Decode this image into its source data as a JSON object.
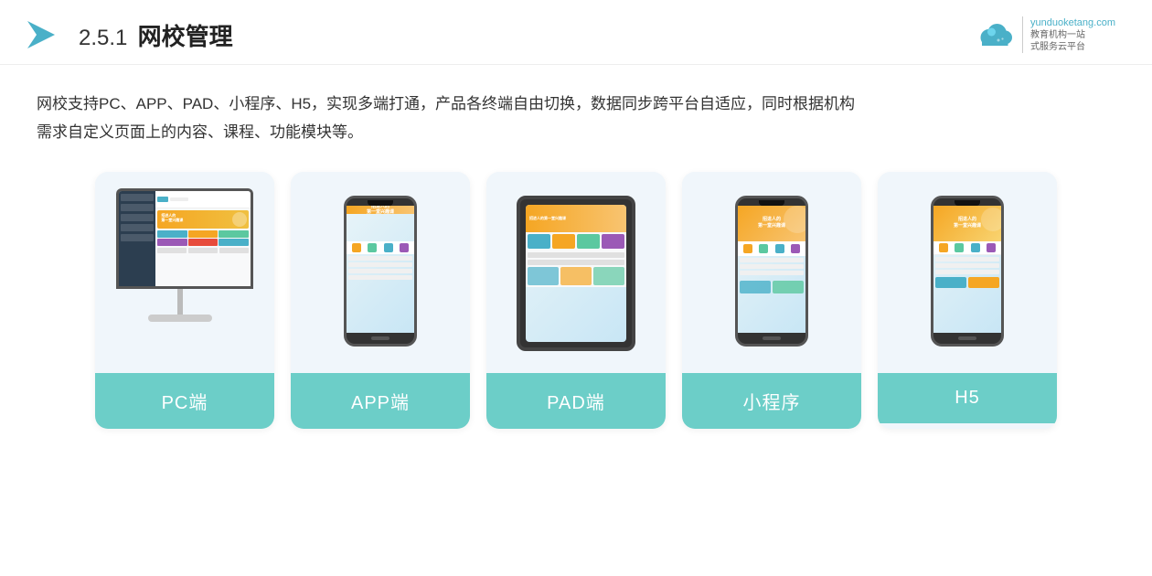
{
  "header": {
    "section_number": "2.5.1",
    "title": "网校管理",
    "brand": {
      "site": "yunduoketang.com",
      "line1": "教育机构一站",
      "line2": "式服务云平台"
    }
  },
  "description": {
    "text_line1": "网校支持PC、APP、PAD、小程序、H5，实现多端打通，产品各终端自由切换，数据同步跨平台自适应，同时根据机构",
    "text_line2": "需求自定义页面上的内容、课程、功能模块等。"
  },
  "cards": [
    {
      "id": "pc",
      "label": "PC端",
      "device": "pc"
    },
    {
      "id": "app",
      "label": "APP端",
      "device": "phone"
    },
    {
      "id": "pad",
      "label": "PAD端",
      "device": "tablet"
    },
    {
      "id": "miniprogram",
      "label": "小程序",
      "device": "phone"
    },
    {
      "id": "h5",
      "label": "H5",
      "device": "phone"
    }
  ],
  "colors": {
    "card_bg": "#f0f6fb",
    "card_label_bg": "#6ccec8",
    "title_color": "#222",
    "text_color": "#333",
    "accent_teal": "#4ab0c8",
    "accent_orange": "#f5a623"
  }
}
